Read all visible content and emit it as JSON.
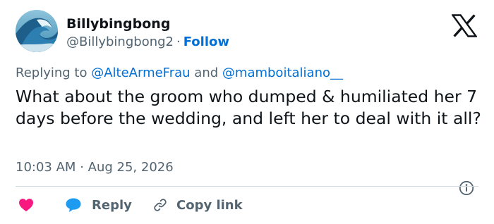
{
  "author": {
    "display_name": "Billybingbong",
    "handle": "@Billybingbong2",
    "separator": "·",
    "follow_label": "Follow"
  },
  "replying": {
    "prefix": "Replying to",
    "mention_1": "@AlteArmeFrau",
    "conjunction": "and",
    "mention_2": "@mamboitaliano__"
  },
  "tweet": {
    "text": "What about the groom who dumped & humiliated her 7 days before the wedding, and left her to deal with it all?",
    "time": "10:03 AM",
    "separator": "·",
    "date": "Aug 25, 2026"
  },
  "actions": {
    "reply_label": "Reply",
    "copy_link_label": "Copy link"
  },
  "icons": {
    "logo": "x-logo-icon",
    "info": "info-icon",
    "like": "heart-icon",
    "reply": "speech-bubble-icon",
    "copy": "link-icon"
  },
  "colors": {
    "accent": "#006fd6",
    "secondary_text": "#536471",
    "like": "#f91880",
    "reply": "#1d9bf0",
    "text": "#0f1419",
    "divider": "#cfd9de"
  }
}
